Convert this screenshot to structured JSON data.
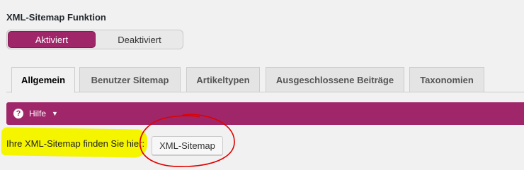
{
  "section": {
    "title": "XML-Sitemap Funktion"
  },
  "toggle": {
    "on_label": "Aktiviert",
    "off_label": "Deaktiviert"
  },
  "tabs": [
    {
      "label": "Allgemein",
      "active": true
    },
    {
      "label": "Benutzer Sitemap",
      "active": false
    },
    {
      "label": "Artikeltypen",
      "active": false
    },
    {
      "label": "Ausgeschlossene Beiträge",
      "active": false
    },
    {
      "label": "Taxonomien",
      "active": false
    }
  ],
  "help": {
    "icon": "?",
    "label": "Hilfe",
    "arrow": "▼"
  },
  "sitemap": {
    "text": "Ihre XML-Sitemap finden Sie hier:",
    "button_label": "XML-Sitemap"
  },
  "colors": {
    "accent": "#a0266a",
    "highlight": "#f5f500",
    "annotation": "#e00000"
  }
}
